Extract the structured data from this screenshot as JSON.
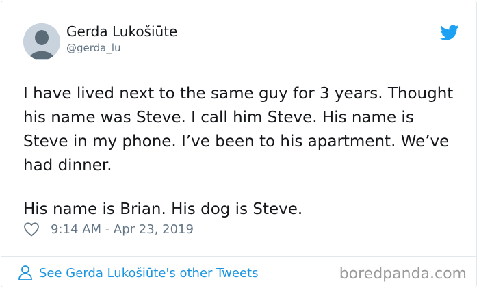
{
  "tweet": {
    "author_name": "Gerda Lukošiūte",
    "author_handle": "@gerda_lu",
    "text_paragraph_1": "I have lived next to the same guy for 3 years. Thought his name was Steve. I call him Steve. His name is Steve in my phone. I’ve been to his apartment. We’ve had dinner.",
    "text_paragraph_2": "His name is Brian. His dog is Steve.",
    "timestamp": "9:14 AM - Apr 23, 2019"
  },
  "footer": {
    "other_tweets_label": "See Gerda Lukošiūte's other Tweets"
  },
  "watermark": "boredpanda.com",
  "icons": {
    "avatar": "default-avatar-icon",
    "brand": "twitter-bird-icon",
    "like": "heart-icon",
    "profile": "person-icon"
  },
  "colors": {
    "link": "#1b95e0",
    "brand": "#1da1f2",
    "muted": "#657786",
    "text": "#14171a",
    "border": "#e1e8ed"
  }
}
